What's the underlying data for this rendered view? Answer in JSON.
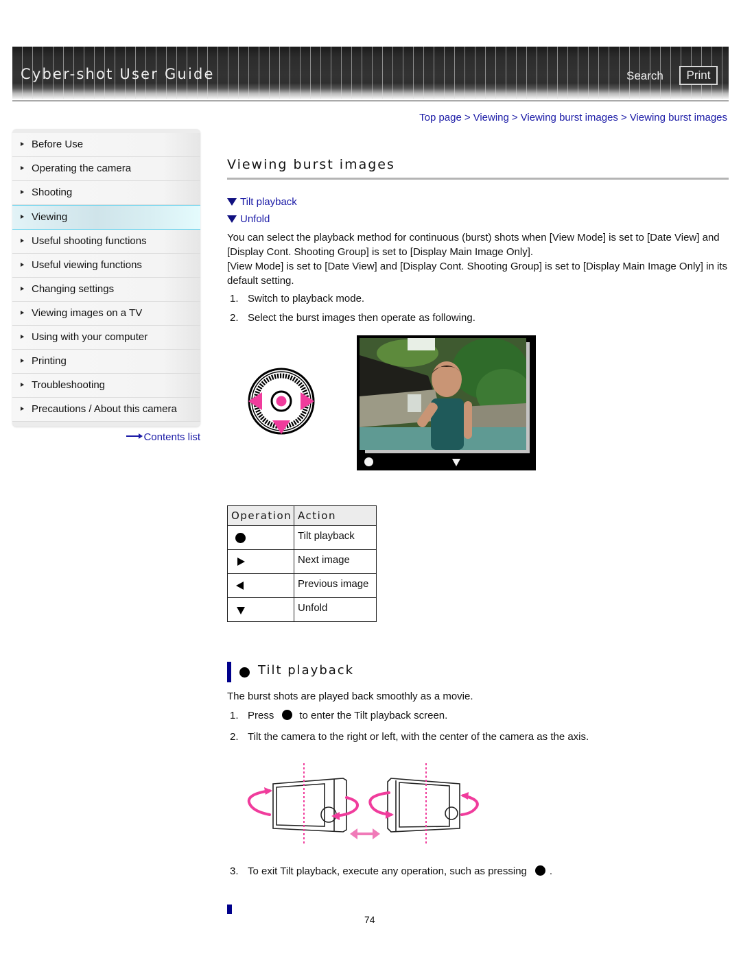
{
  "header": {
    "title": "Cyber-shot User Guide",
    "search_label": "Search",
    "print_label": "Print"
  },
  "breadcrumb": [
    "Top page",
    "Viewing",
    "Viewing burst images",
    "Viewing burst images"
  ],
  "breadcrumb_separator": ">",
  "sidebar": {
    "items": [
      {
        "label": "Before Use",
        "active": false
      },
      {
        "label": "Operating the camera",
        "active": false
      },
      {
        "label": "Shooting",
        "active": false
      },
      {
        "label": "Viewing",
        "active": true
      },
      {
        "label": "Useful shooting functions",
        "active": false
      },
      {
        "label": "Useful viewing functions",
        "active": false
      },
      {
        "label": "Changing settings",
        "active": false
      },
      {
        "label": "Viewing images on a TV",
        "active": false
      },
      {
        "label": "Using with your computer",
        "active": false
      },
      {
        "label": "Printing",
        "active": false
      },
      {
        "label": "Troubleshooting",
        "active": false
      },
      {
        "label": "Precautions / About this camera",
        "active": false
      }
    ],
    "contents_link": "Contents list"
  },
  "main": {
    "title": "Viewing burst images",
    "anchors": [
      "Tilt playback",
      "Unfold"
    ],
    "intro": [
      "You can select the playback method for continuous (burst) shots when [View Mode] is set to [Date View] and [Display Cont. Shooting Group] is set to [Display Main Image Only].",
      "[View Mode] is set to [Date View] and [Display Cont. Shooting Group] is set to [Display Main Image Only] in its default setting."
    ],
    "steps": [
      {
        "num": "1.",
        "text": "Switch to playback mode."
      },
      {
        "num": "2.",
        "text": "Select the burst images then operate as following."
      }
    ],
    "table": {
      "headers": [
        "Operation",
        "Action"
      ],
      "rows": [
        {
          "operation_icon": "center-button-icon",
          "action": "Tilt playback"
        },
        {
          "operation_icon": "right-arrow-icon",
          "action": "Next image"
        },
        {
          "operation_icon": "left-arrow-icon",
          "action": "Previous image"
        },
        {
          "operation_icon": "down-arrow-icon",
          "action": "Unfold"
        }
      ]
    },
    "tilt_section": {
      "title": "Tilt playback",
      "description": "The burst shots are played back smoothly as a movie.",
      "steps": [
        {
          "num": "1.",
          "before": "Press",
          "after": "to enter the Tilt playback screen."
        },
        {
          "num": "2.",
          "text": "Tilt the camera to the right or left, with the center of the camera as the axis."
        },
        {
          "num": "3.",
          "before": "To exit Tilt playback, execute any operation, such as pressing",
          "after": "."
        }
      ]
    }
  },
  "footer": {
    "page_number": "74"
  },
  "colors": {
    "link": "#1a1aa6",
    "accent_bar": "#00008b",
    "highlight_pink": "#f03c9c",
    "active_nav_border": "#76d6ee"
  }
}
